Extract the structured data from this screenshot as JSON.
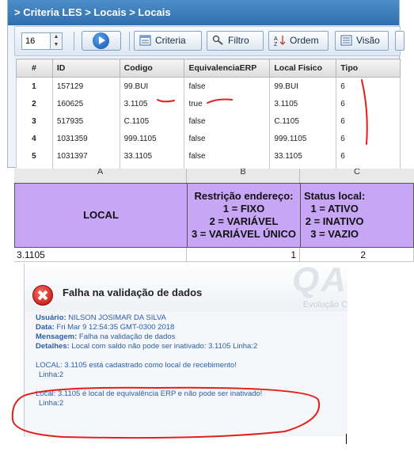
{
  "window": {
    "breadcrumb": "> Criteria LES > Locais > Locais"
  },
  "toolbar": {
    "page_size_value": "16",
    "buttons": {
      "criteria": "Criteria",
      "filtro": "Filtro",
      "ordem": "Ordem",
      "visao": "Visão"
    }
  },
  "grid": {
    "headers": {
      "num": "#",
      "id": "ID",
      "codigo": "Codigo",
      "equivalencia": "EquivalenciaERP",
      "local_fisico": "Local Fisico",
      "tipo": "Tipo"
    },
    "rows": [
      {
        "num": "1",
        "id": "157129",
        "codigo": "99.BUI",
        "equivalencia": "false",
        "local_fisico": "99.BUI",
        "tipo": "6"
      },
      {
        "num": "2",
        "id": "160625",
        "codigo": "3.1105",
        "equivalencia": "true",
        "local_fisico": "3.1105",
        "tipo": "6"
      },
      {
        "num": "3",
        "id": "517935",
        "codigo": "C.1105",
        "equivalencia": "false",
        "local_fisico": "C.1105",
        "tipo": "6"
      },
      {
        "num": "4",
        "id": "1031359",
        "codigo": "999.1105",
        "equivalencia": "false",
        "local_fisico": "999.1105",
        "tipo": "6"
      },
      {
        "num": "5",
        "id": "1031397",
        "codigo": "33.1105",
        "equivalencia": "false",
        "local_fisico": "33.1105",
        "tipo": "6"
      }
    ]
  },
  "spreadsheet": {
    "columns": [
      "A",
      "B",
      "C"
    ],
    "header_cells": {
      "local": "LOCAL",
      "restricao": "Restrição endereço:\n1 = FIXO\n2 = VARIÁVEL\n3 = VARIÁVEL ÚNICO",
      "status": "Status local:\n1 = ATIVO\n2 = INATIVO\n3 = VAZIO"
    },
    "data_row": {
      "local": "3.1105",
      "restricao": "1",
      "status": "2"
    }
  },
  "dialog": {
    "title": "Falha na validação de dados",
    "watermark": "QA",
    "watermark_sub": "Evolução C",
    "usuario_label": "Usuário:",
    "usuario": "NILSON JOSIMAR DA SILVA",
    "data_label": "Data:",
    "data": "Fri Mar 9 12:54:35 GMT-0300 2018",
    "mensagem_label": "Mensagem:",
    "mensagem": "Falha na validação de dados",
    "detalhes_label": "Detalhes:",
    "detalhes": "Local com saldo não pode ser inativado: 3.1105 Linha:2",
    "msg1": "LOCAL: 3.1105 está cadastrado como local de recebimento!",
    "msg1_line": "Linha:2",
    "msg2": "Local: 3.1105 é local de equivalência ERP e não pode ser inativado!",
    "msg2_line": "Linha:2"
  },
  "colors": {
    "titlebar": "#3a7dbe",
    "spreadsheet_header": "#c7a6f5",
    "annotation": "#e0201b",
    "dialog_text": "#2b5fa3"
  }
}
